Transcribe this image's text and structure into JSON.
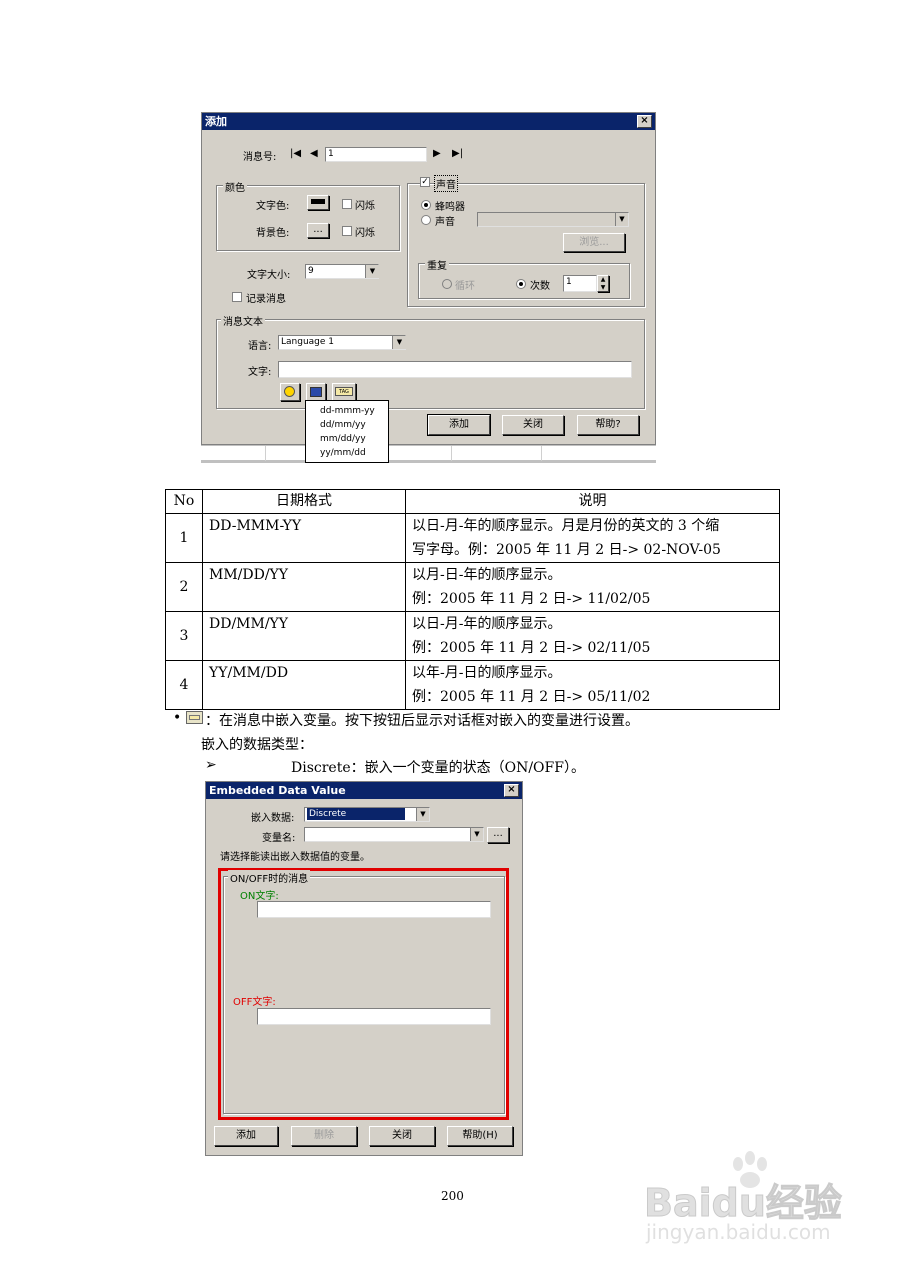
{
  "dialog1": {
    "title": "添加",
    "close_glyph": "×",
    "msg_no_label": "消息号:",
    "msg_no_value": "1",
    "color_group": "颜色",
    "text_color_label": "文字色:",
    "bg_color_label": "背景色:",
    "color_btn": "...",
    "blink1": "闪烁",
    "blink2": "闪烁",
    "sound_group": "声音",
    "buzzer": "蜂鸣器",
    "sound": "声音",
    "browse": "浏览...",
    "repeat_group": "重复",
    "loop": "循环",
    "count": "次数",
    "count_value": "1",
    "font_size_label": "文字大小:",
    "font_size_value": "9",
    "log_msg": "记录消息",
    "msg_text_group": "消息文本",
    "lang_label": "语言:",
    "lang_value": "Language 1",
    "text_label": "文字:",
    "tag_icon_text": "TAG",
    "add_btn": "添加",
    "close_btn": "关闭",
    "help_btn": "帮助?",
    "date_formats": [
      "dd-mmm-yy",
      "dd/mm/yy",
      "mm/dd/yy",
      "yy/mm/dd"
    ]
  },
  "table": {
    "headers": [
      "No",
      "日期格式",
      "说明"
    ],
    "rows": [
      {
        "no": "1",
        "format": "DD-MMM-YY",
        "desc1": "以日-月-年的顺序显示。月是月份的英文的 3 个缩",
        "desc2": "写字母。例：2005 年 11 月 2 日-> 02-NOV-05"
      },
      {
        "no": "2",
        "format": "MM/DD/YY",
        "desc1": "以月-日-年的顺序显示。",
        "desc2": "例：2005 年 11 月 2 日-> 11/02/05"
      },
      {
        "no": "3",
        "format": "DD/MM/YY",
        "desc1": "以日-月-年的顺序显示。",
        "desc2": "例：2005 年 11 月 2 日-> 02/11/05"
      },
      {
        "no": "4",
        "format": "YY/MM/DD",
        "desc1": "以年-月-日的顺序显示。",
        "desc2": "例：2005 年 11 月 2 日-> 05/11/02"
      }
    ]
  },
  "text": {
    "bullet": "•",
    "bullet_line": "：在消息中嵌入变量。按下按钮后显示对话框对嵌入的变量进行设置。",
    "types_line": "嵌入的数据类型：",
    "arrow": "➢",
    "discrete_line": "Discrete：嵌入一个变量的状态（ON/OFF）。"
  },
  "dialog2": {
    "title": "Embedded Data Value",
    "close_glyph": "×",
    "embed_label": "嵌入数据:",
    "embed_value": "Discrete",
    "var_label": "变量名:",
    "var_btn": "...",
    "hint": "请选择能读出嵌入数据值的变量。",
    "onoff_group": "ON/OFF时的消息",
    "on_label": "ON文字:",
    "off_label": "OFF文字:",
    "add_btn": "添加",
    "delete_btn": "删除",
    "close_btn": "关闭",
    "help_btn": "帮助(H)",
    "colors": {
      "on_label": "#008000",
      "off_label": "#e00000",
      "highlight_box": "#e00000",
      "titlebar": "#0a246a"
    }
  },
  "page_number": "200",
  "watermark": {
    "brand": "Baidu经验",
    "url": "jingyan.baidu.com"
  }
}
